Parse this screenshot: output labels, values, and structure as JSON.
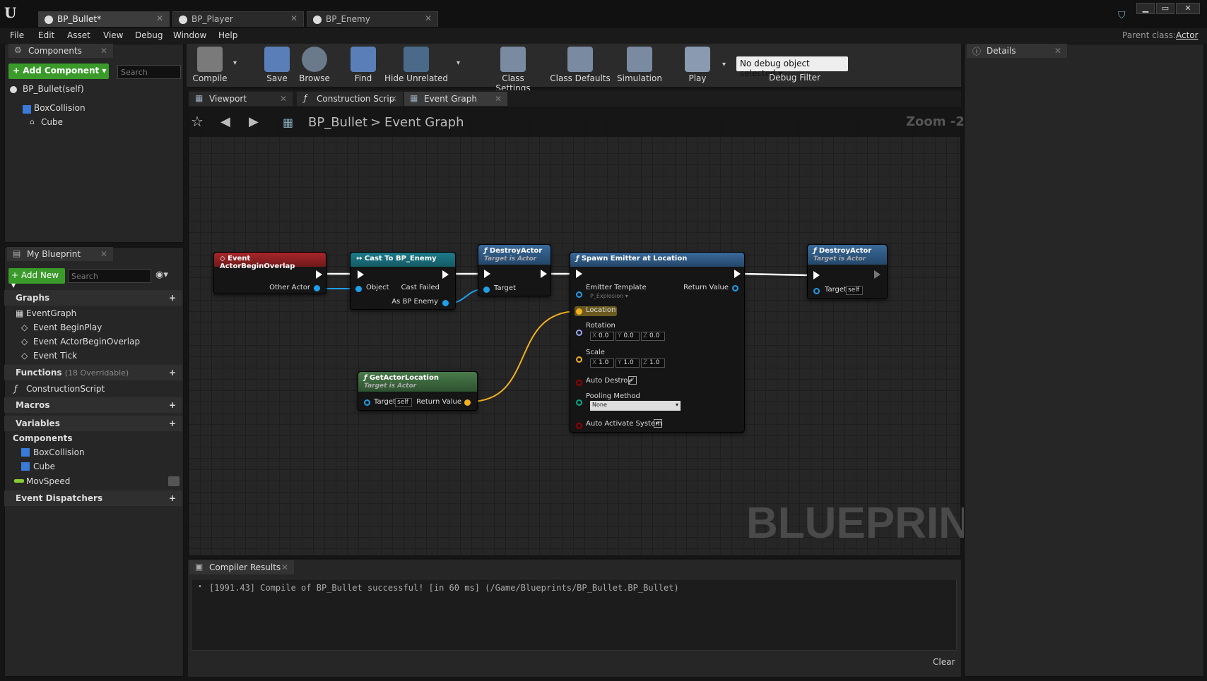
{
  "tabs": [
    {
      "label": "BP_Bullet*"
    },
    {
      "label": "BP_Player"
    },
    {
      "label": "BP_Enemy"
    }
  ],
  "window_buttons": {
    "min": "▁",
    "max": "▭",
    "close": "✕"
  },
  "menu": [
    "File",
    "Edit",
    "Asset",
    "View",
    "Debug",
    "Window",
    "Help"
  ],
  "parent_class": {
    "label": "Parent class:",
    "value": "Actor"
  },
  "components_panel": {
    "title": "Components",
    "add_label": "+ Add Component ▾",
    "search_placeholder": "Search",
    "self": "BP_Bullet(self)",
    "items": [
      "BoxCollision",
      "Cube"
    ]
  },
  "my_blueprint": {
    "title": "My Blueprint",
    "add_new": "+ Add New ▾",
    "search_placeholder": "Search",
    "graphs": "Graphs",
    "event_graph": "EventGraph",
    "events": [
      "Event BeginPlay",
      "Event ActorBeginOverlap",
      "Event Tick"
    ],
    "functions": "Functions",
    "functions_note": "(18 Overridable)",
    "construction": "ConstructionScript",
    "macros": "Macros",
    "variables": "Variables",
    "components": "Components",
    "component_items": [
      "BoxCollision",
      "Cube"
    ],
    "variable": "MovSpeed",
    "dispatchers": "Event Dispatchers"
  },
  "toolbar": {
    "compile": "Compile",
    "save": "Save",
    "browse": "Browse",
    "find": "Find",
    "hide_unrelated": "Hide Unrelated",
    "class_settings": "Class Settings",
    "class_defaults": "Class Defaults",
    "simulation": "Simulation",
    "play": "Play",
    "debug_select": "No debug object selected ▾",
    "debug_filter": "Debug Filter"
  },
  "editor_tabs": [
    "Viewport",
    "Construction Scrip",
    "Event Graph"
  ],
  "breadcrumb": {
    "root": "BP_Bullet",
    "sep": ">",
    "leaf": "Event Graph"
  },
  "zoom": "Zoom -2",
  "watermark": "BLUEPRINT",
  "details": {
    "title": "Details"
  },
  "nodes": {
    "overlap": {
      "title": "Event ActorBeginOverlap",
      "pin": "Other Actor"
    },
    "cast": {
      "title": "Cast To BP_Enemy",
      "object": "Object",
      "failed": "Cast Failed",
      "as": "As BP Enemy"
    },
    "destroy1": {
      "title": "DestroyActor",
      "sub": "Target is Actor",
      "target": "Target"
    },
    "spawn": {
      "title": "Spawn Emitter at Location",
      "template": "Emitter Template",
      "template_val": "P_Explosion ▾",
      "ret": "Return Value",
      "location": "Location",
      "rotation": "Rotation",
      "scale": "Scale",
      "rot": [
        "0.0",
        "0.0",
        "0.0"
      ],
      "scl": [
        "1.0",
        "1.0",
        "1.0"
      ],
      "axes": [
        "X",
        "Y",
        "Z"
      ],
      "auto_destroy": "Auto Destroy",
      "pooling": "Pooling Method",
      "pooling_val": "None",
      "auto_activate": "Auto Activate System"
    },
    "destroy2": {
      "title": "DestroyActor",
      "sub": "Target is Actor",
      "target": "Target",
      "self": "self"
    },
    "getloc": {
      "title": "GetActorLocation",
      "sub": "Target is Actor",
      "target": "Target",
      "self": "self",
      "ret": "Return Value"
    }
  },
  "compiler": {
    "title": "Compiler Results",
    "message": "[1991.43] Compile of BP_Bullet successful! [in 60 ms] (/Game/Blueprints/BP_Bullet.BP_Bullet)",
    "clear": "Clear"
  }
}
